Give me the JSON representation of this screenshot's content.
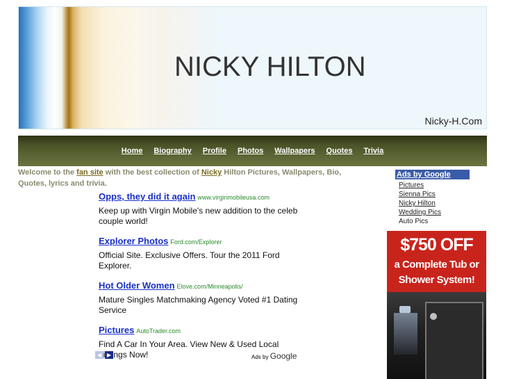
{
  "header": {
    "title": "NICKY HILTON",
    "site_name": "Nicky-H.Com"
  },
  "nav": {
    "items": [
      {
        "label": "Home"
      },
      {
        "label": "Biography"
      },
      {
        "label": "Profile"
      },
      {
        "label": "Photos"
      },
      {
        "label": "Wallpapers"
      },
      {
        "label": "Quotes"
      },
      {
        "label": "Trivia"
      }
    ]
  },
  "welcome": {
    "prefix": "Welcome to the ",
    "link1": "fan site",
    "middle": " with the best collection of ",
    "link2": "Nicky",
    "suffix": " Hilton Pictures, Wallpapers, Bio, Quotes, lyrics and trivia."
  },
  "ads": [
    {
      "title": "Opps, they did it again",
      "url": "www.virginmobileusa.com",
      "desc": "Keep up with Virgin Mobile's new addition to the celeb couple world!"
    },
    {
      "title": "Explorer Photos",
      "url": "Ford.com/Explorer",
      "desc": "Official Site. Exclusive Offers. Tour the 2011 Ford Explorer."
    },
    {
      "title": "Hot Older Women",
      "url": "Elove.com/Minneapolis/",
      "desc": "Mature Singles Matchmaking Agency Voted #1 Dating Service"
    },
    {
      "title": "Pictures",
      "url": "AutoTrader.com",
      "desc": "Find A Car In Your Area. View New & Used Local Listings Now!"
    }
  ],
  "ads_footer": {
    "prev_icon": "chevron-left-icon",
    "next_icon": "chevron-right-icon",
    "ads_by": "Ads by",
    "google": "Google"
  },
  "sidebar": {
    "heading": "Ads by Google",
    "links": [
      "Pictures",
      "Sienna Pics",
      "Nicky Hilton",
      "Wedding Pics",
      "Auto Pics"
    ]
  },
  "promo": {
    "amount": "$750 OFF",
    "line2": "a Complete Tub or",
    "line3": "Shower System!"
  },
  "colors": {
    "nav_bg": "#4a5228",
    "ad_title": "#1a30c8",
    "ad_url": "#2a8a2a",
    "sidebar_head": "#3a5ca8",
    "promo_red": "#c8241c"
  }
}
